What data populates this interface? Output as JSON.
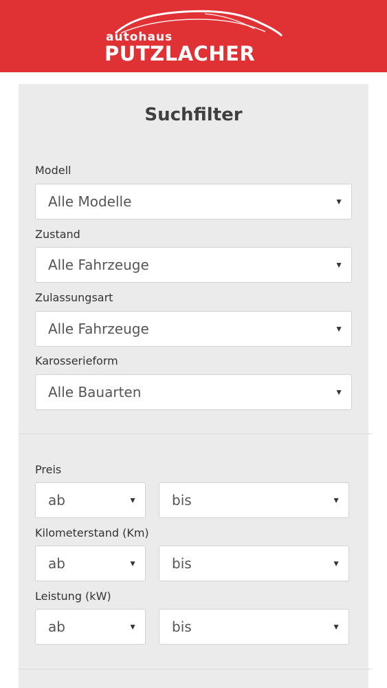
{
  "header": {
    "brand_top": "autohaus",
    "brand_bottom": "PUTZLACHER",
    "colors": {
      "background": "#e03134",
      "logo": "#ffffff"
    }
  },
  "filter": {
    "title": "Suchfilter",
    "fields": [
      {
        "label": "Modell",
        "value": "Alle Modelle"
      },
      {
        "label": "Zustand",
        "value": "Alle Fahrzeuge"
      },
      {
        "label": "Zulassungsart",
        "value": "Alle Fahrzeuge"
      },
      {
        "label": "Karosserieform",
        "value": "Alle Bauarten"
      }
    ],
    "ranges": [
      {
        "label": "Preis",
        "from": "ab",
        "to": "bis"
      },
      {
        "label": "Kilometerstand (Km)",
        "from": "ab",
        "to": "bis"
      },
      {
        "label": "Leistung (kW)",
        "from": "ab",
        "to": "bis"
      }
    ],
    "arrow_glyph": "▼",
    "panel_color": "#ebebeb"
  }
}
